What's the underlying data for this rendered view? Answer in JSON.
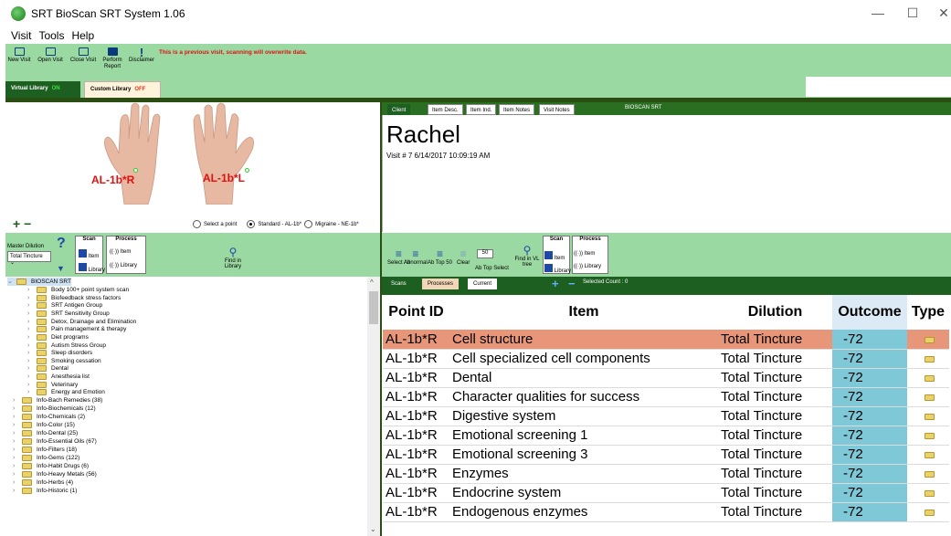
{
  "app": {
    "title": "SRT BioScan SRT System 1.06"
  },
  "menu": [
    "Visit",
    "Tools",
    "Help"
  ],
  "toolbar": {
    "buttons": [
      {
        "label": "New Visit"
      },
      {
        "label": "Open Visit"
      },
      {
        "label": "Close Visit"
      },
      {
        "label": "Perform Report"
      },
      {
        "label": "Disclaimer"
      }
    ],
    "warning": "This is a previous visit, scanning will overwrite data."
  },
  "libraries": {
    "virtual_label": "Virtual Library",
    "virtual_state": "ON",
    "custom_label": "Custom Library",
    "custom_state": "OFF"
  },
  "hands": {
    "left_label": "AL-1b*R",
    "right_label": "AL-1b*L"
  },
  "point_options": {
    "select": "Select a point",
    "standard": "Standard - AL-1b*",
    "migraine": "Migraine - NE-1b*"
  },
  "left_controls": {
    "master_dilution_label": "Master Dilution",
    "dilution_value": "Total Tincture",
    "scan_label": "Scan",
    "process_label": "Process",
    "item": "Item",
    "library": "Library",
    "find": "Find in Library"
  },
  "tree": {
    "root": "BIOSCAN SRT",
    "children": [
      "Body 100+ point system scan",
      "Biofeedback stress factors",
      "SRT Antigen Group",
      "SRT Sensitivity Group",
      "Detox, Drainage and Elimination",
      "Pain management & therapy",
      "Diet programs",
      "Autism Stress Group",
      "Sleep disorders",
      "Smoking cessation",
      "Dental",
      "Anesthesia list",
      "Veterinary",
      "Energy and Emotion"
    ],
    "info": [
      "Info-Bach Remedies (38)",
      "Info-Biochemicals (12)",
      "Info-Chemicals (2)",
      "Info-Color (15)",
      "Info-Dental (25)",
      "Info-Essential Oils (67)",
      "Info-Filters (18)",
      "Info-Gems (122)",
      "Info-Habit Drugs (6)",
      "Info-Heavy Metals (56)",
      "Info-Herbs (4)",
      "Info-Historic (1)"
    ]
  },
  "client_tabs": [
    "Client",
    "Item Desc.",
    "Item Ind.",
    "Item Notes",
    "Visit Notes"
  ],
  "client_tab_extra": "BIOSCAN SRT",
  "client": {
    "name": "Rachel",
    "visit": "Visit # 7    6/14/2017 10:09:19 AM"
  },
  "right_controls": {
    "select_all": "Select All",
    "abnormal": "Abnormal",
    "ab_top_50": "Ab Top 50",
    "clear": "Clear",
    "ab_top_select": "Ab Top Select",
    "top_value": "50",
    "find": "Find in VL tree",
    "scan": "Scan",
    "process": "Process",
    "item": "Item",
    "library": "Library"
  },
  "result_tabs": {
    "scans": "Scans",
    "processes": "Processes",
    "current": "Current",
    "selected_count": "Selected Count : 0"
  },
  "grid": {
    "headers": [
      "Point ID",
      "Item",
      "Dilution",
      "Outcome",
      "Type"
    ],
    "rows": [
      {
        "point": "AL-1b*R",
        "item": "Cell structure",
        "dilution": "Total Tincture",
        "outcome": "-72"
      },
      {
        "point": "AL-1b*R",
        "item": "Cell specialized cell components",
        "dilution": "Total Tincture",
        "outcome": "-72"
      },
      {
        "point": "AL-1b*R",
        "item": "Dental",
        "dilution": "Total Tincture",
        "outcome": "-72"
      },
      {
        "point": "AL-1b*R",
        "item": "Character qualities for success",
        "dilution": "Total Tincture",
        "outcome": "-72"
      },
      {
        "point": "AL-1b*R",
        "item": "Digestive system",
        "dilution": "Total Tincture",
        "outcome": "-72"
      },
      {
        "point": "AL-1b*R",
        "item": "Emotional screening 1",
        "dilution": "Total Tincture",
        "outcome": "-72"
      },
      {
        "point": "AL-1b*R",
        "item": "Emotional screening 3",
        "dilution": "Total Tincture",
        "outcome": "-72"
      },
      {
        "point": "AL-1b*R",
        "item": "Enzymes",
        "dilution": "Total Tincture",
        "outcome": "-72"
      },
      {
        "point": "AL-1b*R",
        "item": "Endocrine system",
        "dilution": "Total Tincture",
        "outcome": "-72"
      },
      {
        "point": "AL-1b*R",
        "item": "Endogenous enzymes",
        "dilution": "Total Tincture",
        "outcome": "-72"
      }
    ]
  },
  "colors": {
    "green_bg": "#9bd9a2",
    "dark_green": "#1d5e21",
    "selected_row": "#e8967a",
    "outcome_cell": "#7ec8d8",
    "warning": "#e01010"
  }
}
